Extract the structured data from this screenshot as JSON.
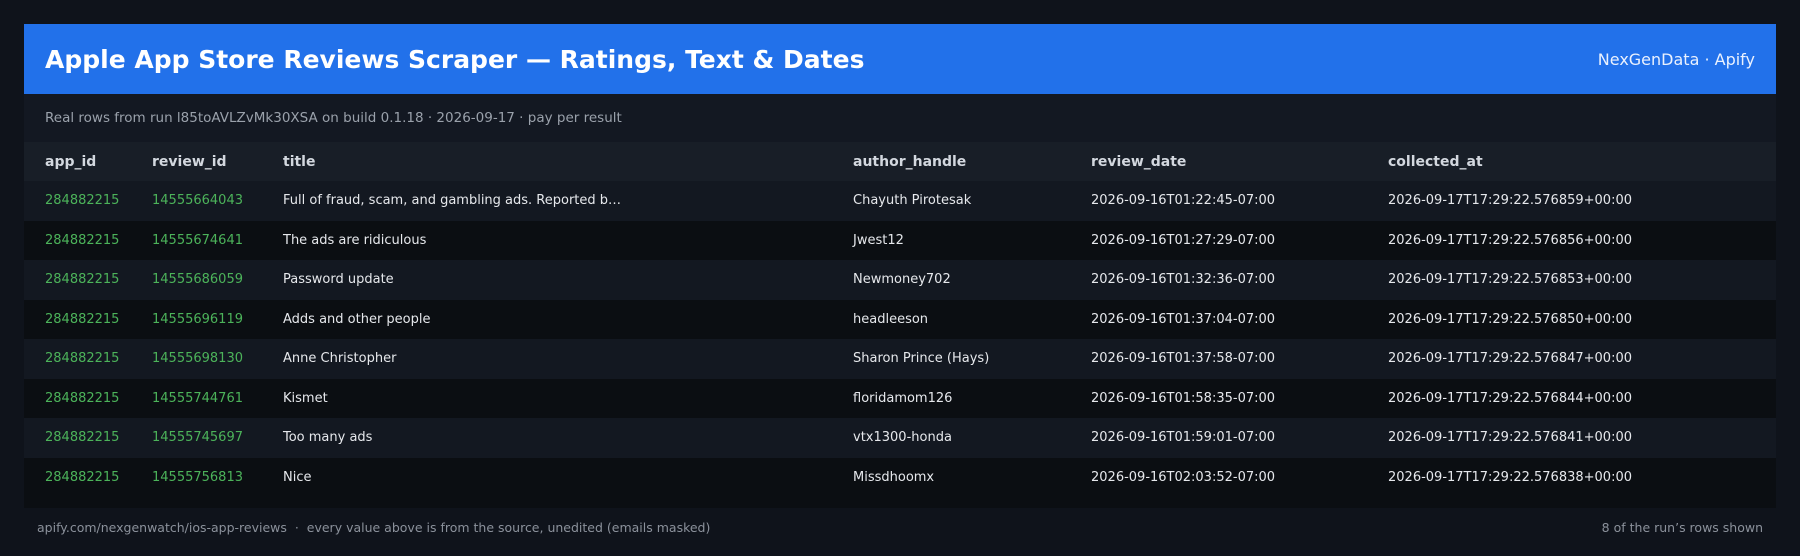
{
  "header": {
    "title": "Apple App Store Reviews Scraper — Ratings, Text & Dates",
    "brand": "NexGenData · Apify"
  },
  "subtitle": "Real rows from run l85toAVLZvMk30XSA on build 0.1.18 · 2026-09-17 · pay per result",
  "table": {
    "columns": [
      "app_id",
      "review_id",
      "title",
      "author_handle",
      "review_date",
      "collected_at"
    ],
    "rows": [
      {
        "app_id": "284882215",
        "review_id": "14555664043",
        "title": "Full of fraud, scam, and gambling ads. Reported b…",
        "author_handle": "Chayuth Pirotesak",
        "review_date": "2026-09-16T01:22:45-07:00",
        "collected_at": "2026-09-17T17:29:22.576859+00:00"
      },
      {
        "app_id": "284882215",
        "review_id": "14555674641",
        "title": "The ads are ridiculous",
        "author_handle": "Jwest12",
        "review_date": "2026-09-16T01:27:29-07:00",
        "collected_at": "2026-09-17T17:29:22.576856+00:00"
      },
      {
        "app_id": "284882215",
        "review_id": "14555686059",
        "title": "Password update",
        "author_handle": "Newmoney702",
        "review_date": "2026-09-16T01:32:36-07:00",
        "collected_at": "2026-09-17T17:29:22.576853+00:00"
      },
      {
        "app_id": "284882215",
        "review_id": "14555696119",
        "title": "Adds and other people",
        "author_handle": "headleeson",
        "review_date": "2026-09-16T01:37:04-07:00",
        "collected_at": "2026-09-17T17:29:22.576850+00:00"
      },
      {
        "app_id": "284882215",
        "review_id": "14555698130",
        "title": "Anne Christopher",
        "author_handle": "Sharon Prince (Hays)",
        "review_date": "2026-09-16T01:37:58-07:00",
        "collected_at": "2026-09-17T17:29:22.576847+00:00"
      },
      {
        "app_id": "284882215",
        "review_id": "14555744761",
        "title": "Kismet",
        "author_handle": "floridamom126",
        "review_date": "2026-09-16T01:58:35-07:00",
        "collected_at": "2026-09-17T17:29:22.576844+00:00"
      },
      {
        "app_id": "284882215",
        "review_id": "14555745697",
        "title": "Too many ads",
        "author_handle": "vtx1300-honda",
        "review_date": "2026-09-16T01:59:01-07:00",
        "collected_at": "2026-09-17T17:29:22.576841+00:00"
      },
      {
        "app_id": "284882215",
        "review_id": "14555756813",
        "title": "Nice",
        "author_handle": "Missdhoomx",
        "review_date": "2026-09-16T02:03:52-07:00",
        "collected_at": "2026-09-17T17:29:22.576838+00:00"
      }
    ]
  },
  "footer": {
    "source": "apify.com/nexgenwatch/ios-app-reviews  ·  every value above is from the source, unedited (emails masked)",
    "count": "8 of the run’s rows shown"
  },
  "colors": {
    "header_bg": "#2271ea",
    "page_bg": "#0f131b",
    "id_text": "#4cb35a"
  }
}
